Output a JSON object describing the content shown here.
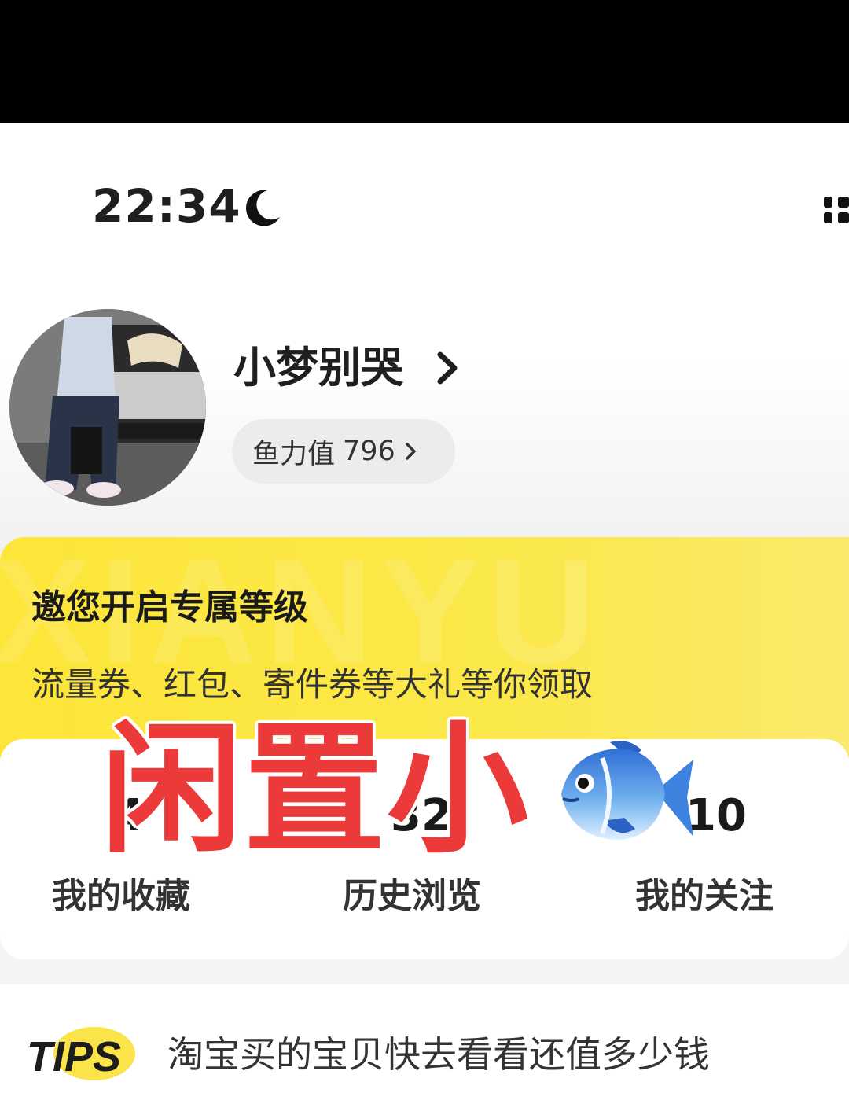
{
  "status_bar": {
    "time": "22:34",
    "icons": [
      "moon-icon",
      "signal-icon"
    ]
  },
  "profile": {
    "username": "小梦别哭",
    "fish_power_label": "鱼力值",
    "fish_power_value": "796"
  },
  "banner": {
    "watermark": "XIANYU",
    "title": "邀您开启专属等级",
    "subtitle": "流量券、红包、寄件券等大礼等你领取"
  },
  "stats": [
    {
      "value": "4",
      "label": "我的收藏"
    },
    {
      "value": "32",
      "label": "历史浏览"
    },
    {
      "value": "10",
      "label": "我的关注"
    }
  ],
  "overlay": {
    "text": "闲置小",
    "emoji_icon": "fish-icon"
  },
  "tips": {
    "badge": "TIPS",
    "text": "淘宝买的宝贝快去看看还值多少钱"
  },
  "colors": {
    "banner_yellow": "#fde539",
    "overlay_red": "#ec3a3a",
    "top_bar": "#000000"
  }
}
